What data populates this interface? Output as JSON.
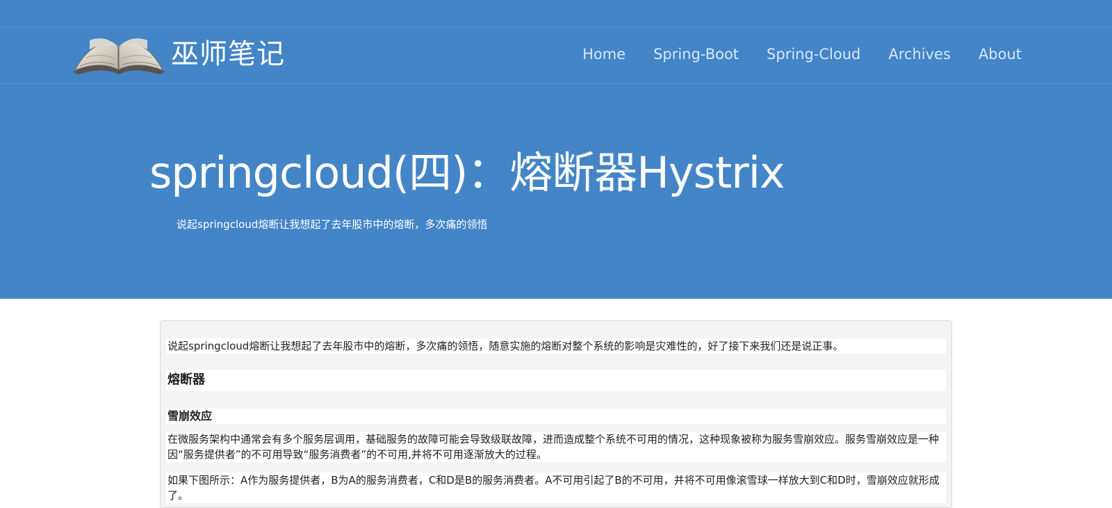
{
  "site": {
    "brand_title": "巫师笔记",
    "brand_logo_icon": "open-book-icon"
  },
  "nav": {
    "items": [
      "Home",
      "Spring-Boot",
      "Spring-Cloud",
      "Archives",
      "About"
    ]
  },
  "hero": {
    "title": "springcloud(四)：熔断器Hystrix",
    "subtitle": "说起springcloud熔断让我想起了去年股市中的熔断，多次痛的领悟"
  },
  "article": {
    "intro": "说起springcloud熔断让我想起了去年股市中的熔断，多次痛的领悟，随意实施的熔断对整个系统的影响是灾难性的，好了接下来我们还是说正事。",
    "heading_1": "熔断器",
    "heading_2": "雪崩效应",
    "paragraph_2": "在微服务架构中通常会有多个服务层调用，基础服务的故障可能会导致级联故障，进而造成整个系统不可用的情况，这种现象被称为服务雪崩效应。服务雪崩效应是一种因“服务提供者”的不可用导致“服务消费者”的不可用,并将不可用逐渐放大的过程。",
    "paragraph_3": "如果下图所示：A作为服务提供者，B为A的服务消费者，C和D是B的服务消费者。A不可用引起了B的不可用，并将不可用像滚雪球一样放大到C和D时，雪崩效应就形成了。"
  },
  "colors": {
    "header_background": "#4385c7",
    "nav_text": "#d7e8fb",
    "title_text": "#ffffff",
    "article_text": "#222222",
    "article_background": "#f4f4f4"
  }
}
